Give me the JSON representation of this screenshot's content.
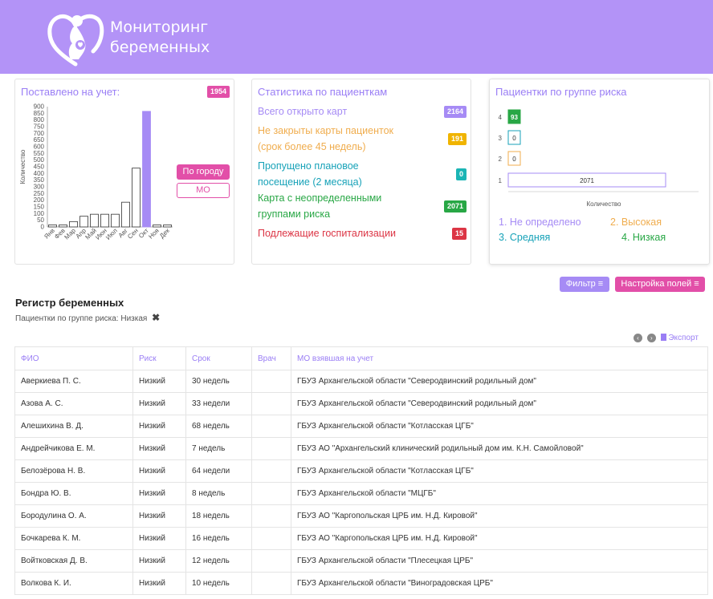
{
  "header": {
    "title_line1": "Мониторинг",
    "title_line2": "беременных",
    "brand_color": "#b393f7"
  },
  "registered": {
    "title": "Поставлено на учет:",
    "total": "1954",
    "btn_city": "По городу",
    "btn_mo": "МО"
  },
  "chart_data": [
    {
      "type": "bar",
      "title": "Поставлено на учет:",
      "ylabel": "Количество",
      "ylim": [
        0,
        900
      ],
      "yticks": [
        0,
        50,
        100,
        150,
        200,
        250,
        300,
        350,
        400,
        450,
        500,
        550,
        600,
        650,
        700,
        750,
        800,
        850,
        900
      ],
      "categories": [
        "Янв",
        "Фев",
        "Мар",
        "Апр",
        "Май",
        "Июн",
        "Июл",
        "Авг",
        "Сен",
        "Окт",
        "Ноя",
        "Дек"
      ],
      "values": [
        15,
        15,
        40,
        80,
        95,
        95,
        95,
        185,
        440,
        865,
        15,
        15
      ],
      "highlight_index": 9,
      "highlight_color": "#a68bf5"
    },
    {
      "type": "bar",
      "orientation": "horizontal",
      "title": "Пациентки по группе риска",
      "xlabel": "Количество",
      "categories": [
        "4",
        "3",
        "2",
        "1"
      ],
      "values": [
        93,
        0,
        0,
        2071
      ],
      "colors": [
        "#28a745",
        "#17a2b8",
        "#f0ad4e",
        "#a68bf5"
      ]
    }
  ],
  "stats": {
    "title": "Статистика по пациенткам",
    "items": [
      {
        "label1": "Всего открыто карт",
        "label2": "",
        "value": "2164",
        "color": "#a68bf5",
        "badge": "#a68bf5"
      },
      {
        "label1": "Не закрыты карты пациенток",
        "label2": "(срок более 45 недель)",
        "value": "191",
        "color": "#f0ad4e",
        "badge": "#f0b400"
      },
      {
        "label1": "Пропущено плановое",
        "label2": "посещение (2 месяца)",
        "value": "0",
        "color": "#17a2b8",
        "badge": "#1bb5b5"
      },
      {
        "label1": "Карта с неопределенными",
        "label2": "группами риска",
        "value": "2071",
        "color": "#28a745",
        "badge": "#28a745"
      },
      {
        "label1": "Подлежащие госпитализации",
        "label2": "",
        "value": "15",
        "color": "#dc3545",
        "badge": "#dc3545"
      }
    ]
  },
  "risk": {
    "title": "Пациентки по группе риска",
    "axis_label": "Количество",
    "legend": [
      {
        "text": "1. Не определено",
        "color": "#a68bf5"
      },
      {
        "text": "2. Высокая",
        "color": "#f0ad4e"
      },
      {
        "text": "3. Средняя",
        "color": "#17a2b8"
      },
      {
        "text": "4. Низкая",
        "color": "#28a745"
      }
    ]
  },
  "toolbar": {
    "filter_label": "Фильтр",
    "fields_label": "Настройка полей",
    "export_label": "Экспорт"
  },
  "registry": {
    "title": "Регистр беременных",
    "filter_text": "Пациентки по группе риска: Низкая",
    "columns": [
      "ФИО",
      "Риск",
      "Срок",
      "Врач",
      "МО взявшая на учет"
    ],
    "rows": [
      [
        "Аверкиева П. С.",
        "Низкий",
        "30 недель",
        "",
        "ГБУЗ Архангельской области \"Северодвинский родильный дом\""
      ],
      [
        "Азова А. С.",
        "Низкий",
        "33 недели",
        "",
        "ГБУЗ Архангельской области \"Северодвинский родильный дом\""
      ],
      [
        "Алешихина В. Д.",
        "Низкий",
        "68 недель",
        "",
        "ГБУЗ Архангельской области \"Котласская ЦГБ\""
      ],
      [
        "Андрейчикова Е. М.",
        "Низкий",
        "7 недель",
        "",
        "ГБУЗ АО \"Архангельский клинический родильный дом им. К.Н. Самойловой\""
      ],
      [
        "Белозёрова Н. В.",
        "Низкий",
        "64 недели",
        "",
        "ГБУЗ Архангельской области \"Котласская ЦГБ\""
      ],
      [
        "Бондра Ю. В.",
        "Низкий",
        "8 недель",
        "",
        "ГБУЗ Архангельской области \"МЦГБ\""
      ],
      [
        "Бородулина О. А.",
        "Низкий",
        "18 недель",
        "",
        "ГБУЗ АО \"Каргопольская ЦРБ им. Н.Д. Кировой\""
      ],
      [
        "Бочкарева К. М.",
        "Низкий",
        "16 недель",
        "",
        "ГБУЗ АО \"Каргопольская ЦРБ им. Н.Д. Кировой\""
      ],
      [
        "Войтковская Д. В.",
        "Низкий",
        "12 недель",
        "",
        "ГБУЗ Архангельской области \"Плесецкая ЦРБ\""
      ],
      [
        "Волкова К. И.",
        "Низкий",
        "10 недель",
        "",
        "ГБУЗ Архангельской области \"Виноградовская ЦРБ\""
      ]
    ]
  }
}
